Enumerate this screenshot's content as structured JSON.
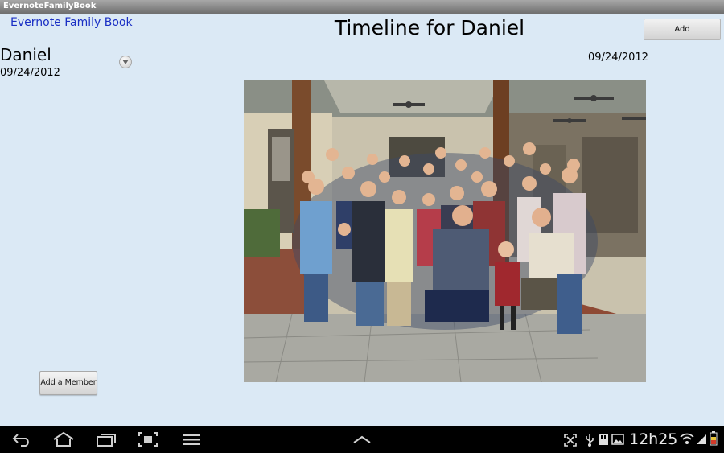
{
  "window": {
    "title": "EvernoteFamilyBook"
  },
  "header": {
    "app_link": "Evernote Family Book",
    "page_title": "Timeline for Daniel",
    "add_button": "Add"
  },
  "sidebar": {
    "member_name": "Daniel",
    "member_date": "09/24/2012",
    "add_member_button": "Add a Member"
  },
  "timeline": {
    "entry_date": "09/24/2012",
    "photo_icon": "family-group-photo"
  },
  "system_bar": {
    "time": "12h25",
    "icons": [
      "back-icon",
      "home-icon",
      "recent-apps-icon",
      "screenshot-icon",
      "menu-icon",
      "up-arrow-icon",
      "fullscreen-icon",
      "usb-icon",
      "sd-card-icon",
      "image-icon",
      "wifi-icon",
      "signal-icon",
      "battery-icon"
    ]
  },
  "colors": {
    "background": "#dbe9f5",
    "link": "#1a2fc4",
    "navbar": "#000000"
  }
}
